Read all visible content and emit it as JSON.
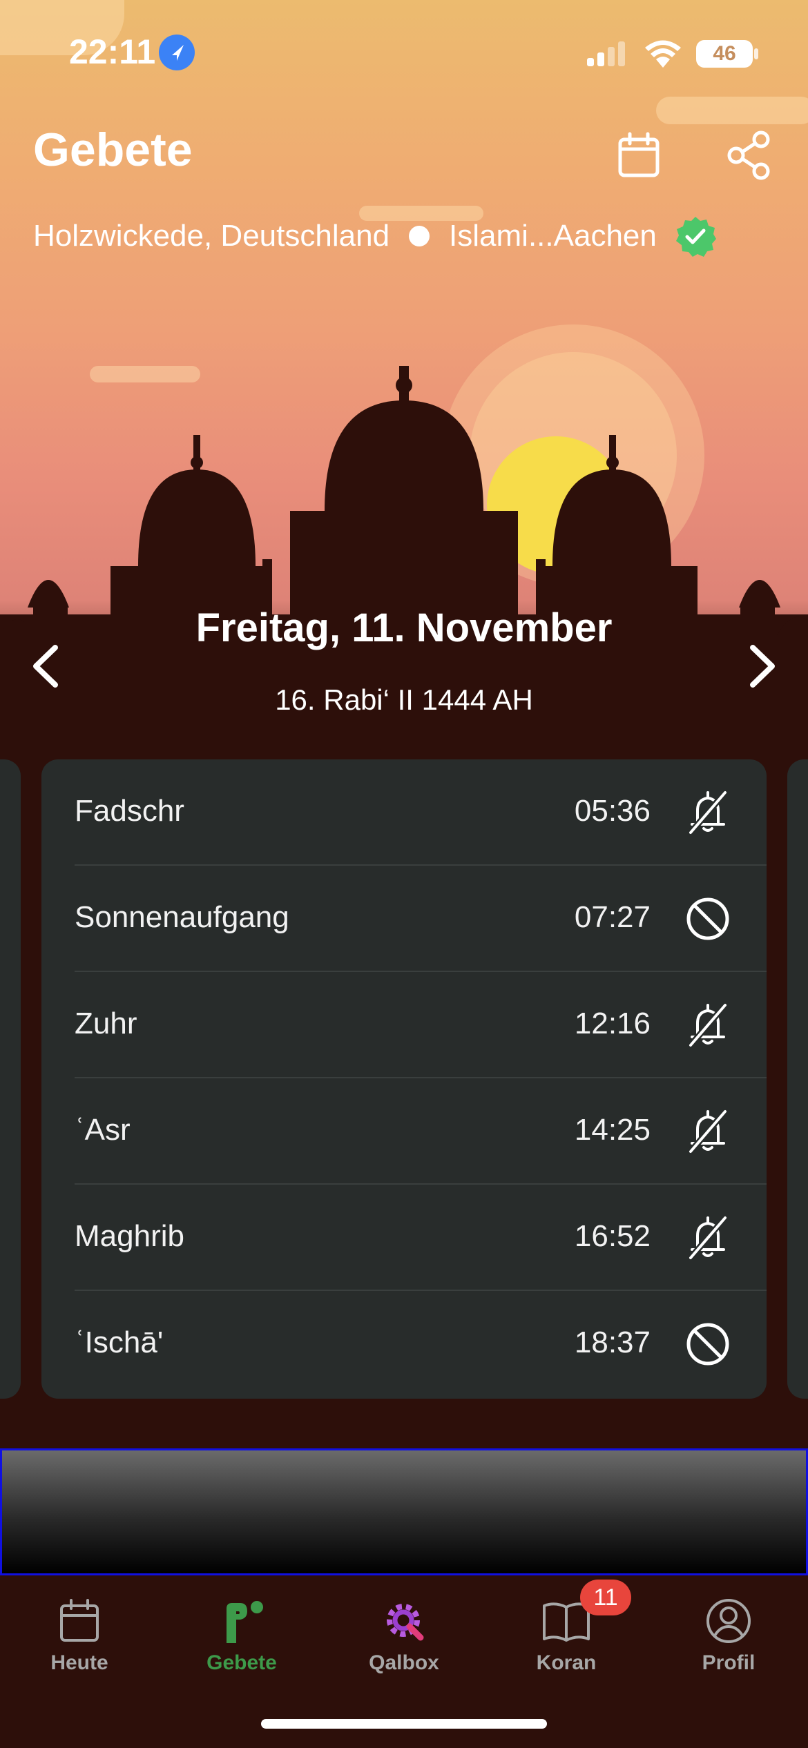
{
  "status_bar": {
    "time": "22:11",
    "battery": "46"
  },
  "header": {
    "title": "Gebete",
    "location": "Holzwickede, Deutschland",
    "method": "Islami...Aachen"
  },
  "date": {
    "gregorian": "Freitag, 11. November",
    "hijri": "16. Rabi‘ II 1444 AH"
  },
  "prayers": [
    {
      "name": "Fadschr",
      "time": "05:36",
      "icon": "bell-off-icon"
    },
    {
      "name": "Sonnenaufgang",
      "time": "07:27",
      "icon": "disabled-icon"
    },
    {
      "name": "Zuhr",
      "time": "12:16",
      "icon": "bell-off-icon"
    },
    {
      "name": "ʿAsr",
      "time": "14:25",
      "icon": "bell-off-icon"
    },
    {
      "name": "Maghrib",
      "time": "16:52",
      "icon": "bell-off-icon"
    },
    {
      "name": "ʿIschā'",
      "time": "18:37",
      "icon": "disabled-icon"
    }
  ],
  "tabs": [
    {
      "label": "Heute",
      "icon": "calendar-icon",
      "active": false
    },
    {
      "label": "Gebete",
      "icon": "prayer-icon",
      "active": true
    },
    {
      "label": "Qalbox",
      "icon": "qalbox-icon",
      "active": false
    },
    {
      "label": "Koran",
      "icon": "book-icon",
      "active": false,
      "badge": "11"
    },
    {
      "label": "Profil",
      "icon": "profile-icon",
      "active": false
    }
  ],
  "colors": {
    "accent_green": "#3d9a4a",
    "badge_red": "#e8453c",
    "card_bg": "#282c2b",
    "sun": "#f7dc4a"
  }
}
